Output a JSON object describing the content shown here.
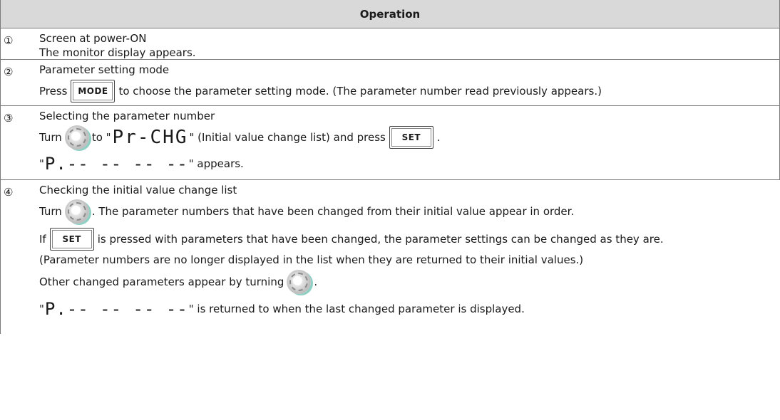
{
  "header": {
    "title": "Operation"
  },
  "steps": [
    {
      "num": "①",
      "lines": [
        "Screen at power-ON",
        "The monitor display appears."
      ]
    },
    {
      "num": "②",
      "title": "Parameter setting mode",
      "press_prefix": "Press",
      "button": "MODE",
      "press_suffix": "to choose the parameter setting mode. (The parameter number read previously appears.)"
    },
    {
      "num": "③",
      "title": "Selecting the parameter number",
      "turn": "Turn",
      "to_quote": "to \"",
      "display": "Pr-CHG",
      "after_display": "\" (Initial value change list) and press",
      "button": "SET",
      "period": ".",
      "quote_open": "\"",
      "display2": "P.-- -- -- --",
      "appears": "\" appears."
    },
    {
      "num": "④",
      "title": "Checking the initial value change list",
      "turn": "Turn",
      "turn_suffix": ". The parameter numbers that have been changed from their initial value appear in order.",
      "if": "If",
      "button": "SET",
      "if_suffix": "is pressed with parameters that have been changed, the parameter settings can be changed as they are.",
      "note": "(Parameter numbers are no longer displayed in the list when they are returned to their initial values.)",
      "other": "Other changed parameters appear by turning",
      "period": ".",
      "quote_open": "\"",
      "display": "P.-- -- -- --",
      "returned": "\" is returned to when the last changed parameter is displayed."
    }
  ]
}
